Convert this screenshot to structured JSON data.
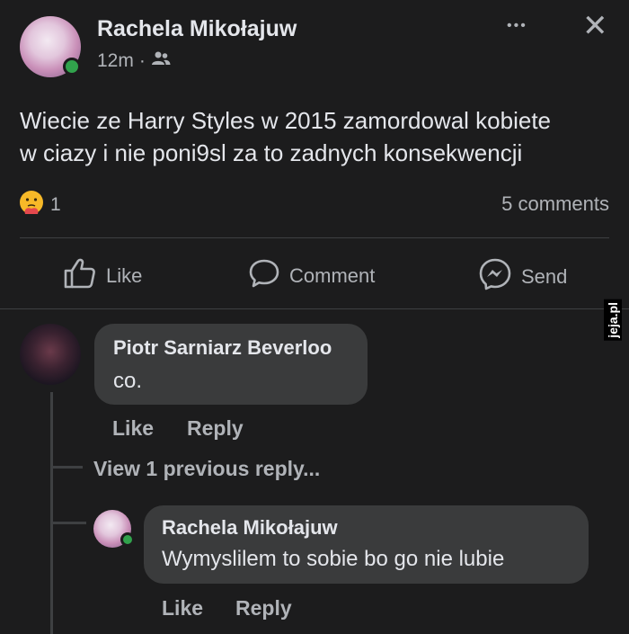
{
  "post": {
    "author": "Rachela Mikołajuw",
    "time": "12m",
    "separator": "·",
    "text_line1": "Wiecie ze Harry Styles w 2015 zamordowal kobiete",
    "text_line2": "w ciazy i nie poni9sl za to zadnych konsekwencji",
    "reaction_count": "1",
    "comments_count": "5 comments",
    "more_glyph": "•••",
    "close_glyph": "✕"
  },
  "actions": {
    "like": "Like",
    "comment": "Comment",
    "send": "Send"
  },
  "comments": [
    {
      "author": "Piotr Sarniarz Beverloo",
      "text": "co.",
      "like": "Like",
      "reply": "Reply"
    }
  ],
  "view_previous": "View 1 previous reply...",
  "reply": {
    "author": "Rachela Mikołajuw",
    "text": "Wymyslilem to sobie bo go nie lubie",
    "like": "Like",
    "reply": "Reply"
  },
  "watermark": "jeja.pl",
  "colors": {
    "background": "#1c1c1d",
    "bubble": "#3a3b3c",
    "online": "#31a24c",
    "reaction": "#f7b928"
  },
  "icons": {
    "audience": "friends-icon",
    "like": "thumbs-up-icon",
    "comment": "speech-bubble-icon",
    "send": "messenger-icon",
    "reaction": "care-emoji-icon"
  }
}
